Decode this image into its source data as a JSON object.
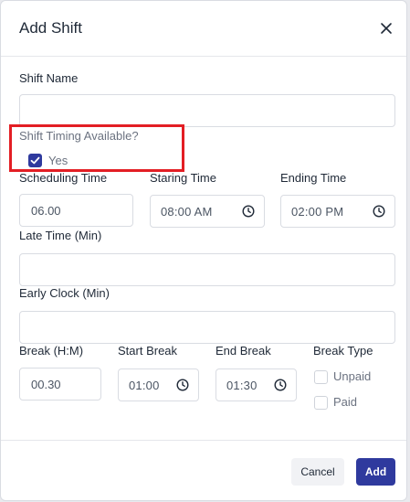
{
  "modal": {
    "title": "Add Shift",
    "close_icon": "close-icon"
  },
  "shift_name": {
    "label": "Shift Name",
    "value": ""
  },
  "shift_timing": {
    "label": "Shift Timing Available?",
    "yes_label": "Yes",
    "checked": true
  },
  "scheduling_time": {
    "label": "Scheduling Time",
    "value": "06.00"
  },
  "starting_time": {
    "label": "Staring Time",
    "value": "08:00  AM"
  },
  "ending_time": {
    "label": "Ending Time",
    "value": "02:00  PM"
  },
  "late_time": {
    "label": "Late Time (Min)",
    "value": ""
  },
  "early_clock": {
    "label": "Early Clock (Min)",
    "value": ""
  },
  "break": {
    "label": "Break (H:M)",
    "value": "00.30"
  },
  "start_break": {
    "label": "Start Break",
    "value": "01:00"
  },
  "end_break": {
    "label": "End Break",
    "value": "01:30"
  },
  "break_type": {
    "label": "Break Type",
    "options": [
      {
        "label": "Unpaid",
        "checked": false
      },
      {
        "label": "Paid",
        "checked": false
      }
    ]
  },
  "footer": {
    "cancel_label": "Cancel",
    "add_label": "Add"
  },
  "colors": {
    "primary": "#2f3a9e",
    "highlight": "#e31e24"
  }
}
